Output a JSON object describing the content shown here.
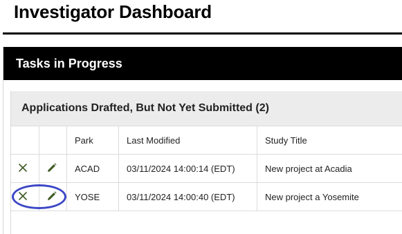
{
  "page": {
    "title": "Investigator Dashboard"
  },
  "panel": {
    "title": "Tasks in Progress"
  },
  "card": {
    "title": "Applications Drafted, But Not Yet Submitted (2)"
  },
  "table": {
    "columns": [
      "",
      "",
      "Park",
      "Last Modified",
      "Study Title"
    ],
    "rows": [
      {
        "park": "ACAD",
        "last_modified": "03/11/2024 14:00:14 (EDT)",
        "study_title": "New project at Acadia"
      },
      {
        "park": "YOSE",
        "last_modified": "03/11/2024 14:00:40 (EDT)",
        "study_title": "New project a Yosemite"
      }
    ]
  },
  "icons": {
    "delete": "close-icon",
    "edit": "pencil-icon"
  },
  "colors": {
    "icon": "#3f5a24",
    "highlight": "#3b46c6",
    "header_bg": "#000000",
    "card_header_bg": "#ececec"
  }
}
